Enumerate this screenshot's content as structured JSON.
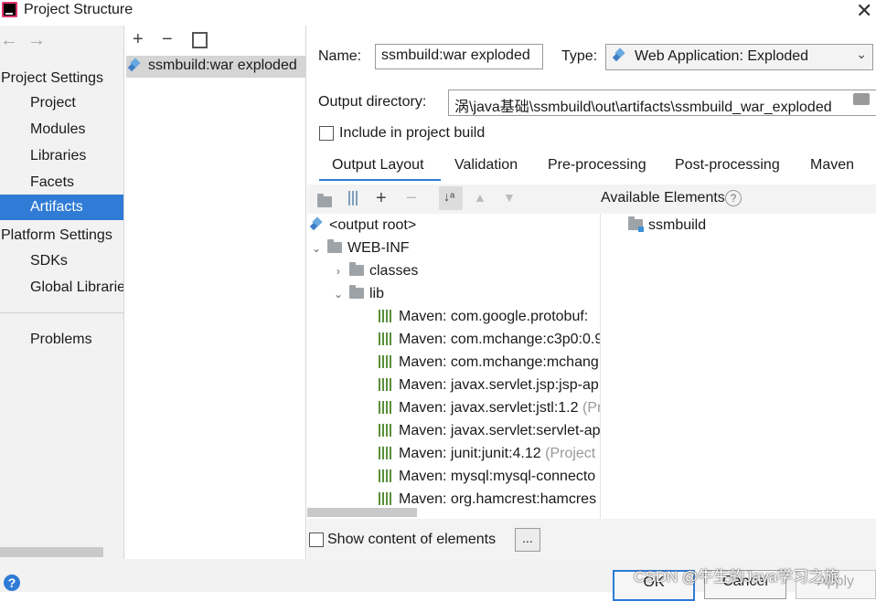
{
  "window": {
    "title": "Project Structure"
  },
  "nav": {
    "project_settings": "Project Settings",
    "items": [
      "Project",
      "Modules",
      "Libraries",
      "Facets",
      "Artifacts"
    ],
    "platform_settings": "Platform Settings",
    "platform_items": [
      "SDKs",
      "Global Libraries"
    ],
    "problems": "Problems",
    "selected": "Artifacts"
  },
  "artifacts": {
    "items": [
      "ssmbuild:war exploded"
    ]
  },
  "form": {
    "name_label": "Name:",
    "name_value": "ssmbuild:war exploded",
    "type_label": "Type:",
    "type_value": "Web Application: Exploded",
    "output_label": "Output directory:",
    "output_value": "涡\\java基础\\ssmbuild\\out\\artifacts\\ssmbuild_war_exploded",
    "include_label": "Include in project build",
    "include_checked": false
  },
  "tabs": [
    "Output Layout",
    "Validation",
    "Pre-processing",
    "Post-processing",
    "Maven"
  ],
  "active_tab": "Output Layout",
  "tree": {
    "root": "<output root>",
    "webinf": "WEB-INF",
    "classes": "classes",
    "lib": "lib",
    "libs": [
      {
        "name": "Maven: com.google.protobuf:",
        "note": ""
      },
      {
        "name": "Maven: com.mchange:c3p0:0.9",
        "note": ""
      },
      {
        "name": "Maven: com.mchange:mchang",
        "note": ""
      },
      {
        "name": "Maven: javax.servlet.jsp:jsp-ap",
        "note": ""
      },
      {
        "name": "Maven: javax.servlet:jstl:1.2",
        "note": "(Pr"
      },
      {
        "name": "Maven: javax.servlet:servlet-ap",
        "note": ""
      },
      {
        "name": "Maven: junit:junit:4.12",
        "note": "(Project"
      },
      {
        "name": "Maven: mysql:mysql-connecto",
        "note": ""
      },
      {
        "name": "Maven: org.hamcrest:hamcres",
        "note": ""
      }
    ]
  },
  "available": {
    "header": "Available Elements",
    "help": "?",
    "items": [
      "ssmbuild"
    ]
  },
  "bottom": {
    "show_content": "Show content of elements",
    "ellipsis": "..."
  },
  "footer": {
    "ok": "OK",
    "cancel": "Cancel",
    "apply": "Apply",
    "help": "?"
  },
  "watermark": "CSDN @牛生的Java学习之旅",
  "colors": {
    "accent": "#2f7bd6",
    "selection": "#d5d5d5"
  }
}
